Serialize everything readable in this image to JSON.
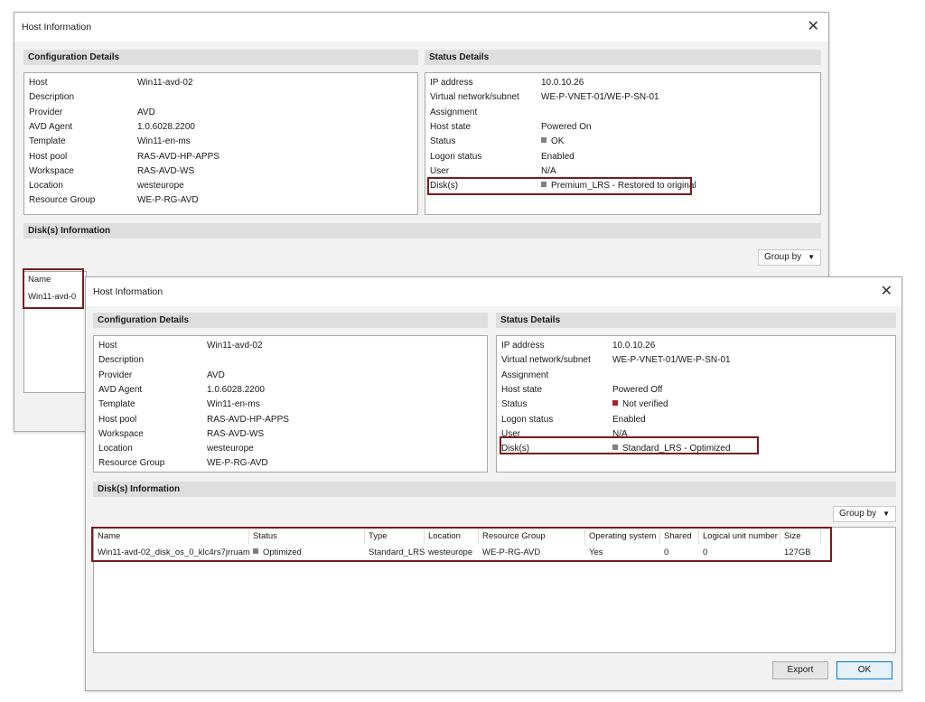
{
  "back": {
    "title": "Host Information",
    "close": "✕",
    "config_header": "Configuration Details",
    "status_header": "Status Details",
    "disks_header": "Disk(s) Information",
    "group_by": "Group by",
    "config": [
      {
        "k": "Host",
        "v": "Win11-avd-02"
      },
      {
        "k": "Description",
        "v": ""
      },
      {
        "k": "Provider",
        "v": "AVD"
      },
      {
        "k": "AVD Agent",
        "v": "1.0.6028.2200"
      },
      {
        "k": "Template",
        "v": "Win11-en-ms"
      },
      {
        "k": "Host pool",
        "v": "RAS-AVD-HP-APPS"
      },
      {
        "k": "Workspace",
        "v": "RAS-AVD-WS"
      },
      {
        "k": "Location",
        "v": "westeurope"
      },
      {
        "k": "Resource Group",
        "v": "WE-P-RG-AVD"
      }
    ],
    "status": [
      {
        "k": "IP address",
        "v": "10.0.10.26"
      },
      {
        "k": "Virtual network/subnet",
        "v": "WE-P-VNET-01/WE-P-SN-01"
      },
      {
        "k": "Assignment",
        "v": ""
      },
      {
        "k": "Host state",
        "v": "Powered On"
      },
      {
        "k": "Status",
        "v": "OK"
      },
      {
        "k": "Logon status",
        "v": "Enabled"
      },
      {
        "k": "User",
        "v": "N/A"
      },
      {
        "k": "Disk(s)",
        "v": "Premium_LRS - Restored to original"
      }
    ],
    "table_name_header": "Name",
    "table_first_cell": "Win11-avd-0"
  },
  "front": {
    "title": "Host Information",
    "close": "✕",
    "config_header": "Configuration Details",
    "status_header": "Status Details",
    "disks_header": "Disk(s) Information",
    "group_by": "Group by",
    "config": [
      {
        "k": "Host",
        "v": "Win11-avd-02"
      },
      {
        "k": "Description",
        "v": ""
      },
      {
        "k": "Provider",
        "v": "AVD"
      },
      {
        "k": "AVD Agent",
        "v": "1.0.6028.2200"
      },
      {
        "k": "Template",
        "v": "Win11-en-ms"
      },
      {
        "k": "Host pool",
        "v": "RAS-AVD-HP-APPS"
      },
      {
        "k": "Workspace",
        "v": "RAS-AVD-WS"
      },
      {
        "k": "Location",
        "v": "westeurope"
      },
      {
        "k": "Resource Group",
        "v": "WE-P-RG-AVD"
      }
    ],
    "status": [
      {
        "k": "IP address",
        "v": "10.0.10.26"
      },
      {
        "k": "Virtual network/subnet",
        "v": "WE-P-VNET-01/WE-P-SN-01"
      },
      {
        "k": "Assignment",
        "v": ""
      },
      {
        "k": "Host state",
        "v": "Powered Off"
      },
      {
        "k": "Status",
        "v": "Not verified"
      },
      {
        "k": "Logon status",
        "v": "Enabled"
      },
      {
        "k": "User",
        "v": "N/A"
      },
      {
        "k": "Disk(s)",
        "v": "Standard_LRS - Optimized"
      }
    ],
    "columns": [
      "Name",
      "Status",
      "Type",
      "Location",
      "Resource Group",
      "Operating system",
      "Shared",
      "Logical unit number",
      "Size"
    ],
    "rows": [
      [
        "Win11-avd-02_disk_os_0_klc4rs7jrruam",
        "Optimized",
        "Standard_LRS",
        "westeurope",
        "WE-P-RG-AVD",
        "Yes",
        "0",
        "0",
        "127GB"
      ]
    ],
    "export_label": "Export",
    "ok_label": "OK"
  },
  "colors": {
    "highlight": "#7a1b20",
    "status_not_verified": "#a3242a",
    "status_ok": "#7f7f7f"
  }
}
